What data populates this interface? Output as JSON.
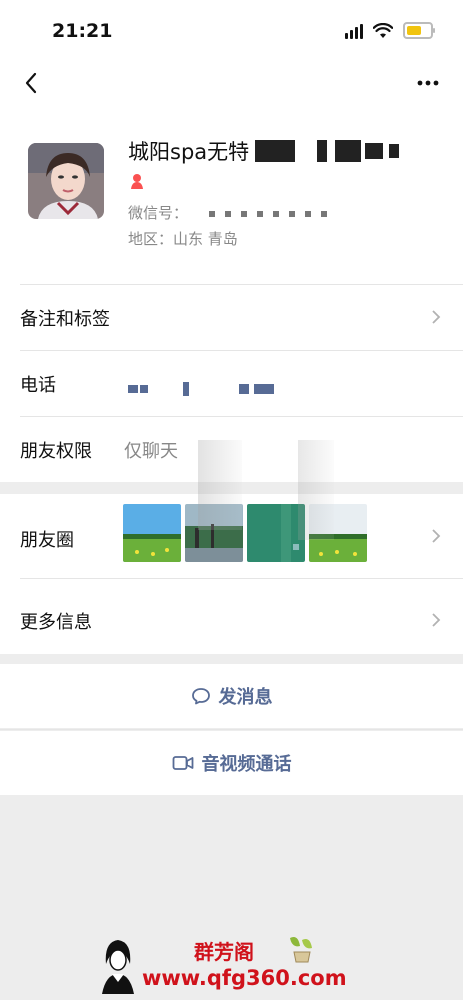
{
  "status": {
    "time": "21:21"
  },
  "nav": {
    "back_icon": "chevron-left-icon",
    "more_icon": "more-dots-icon"
  },
  "profile": {
    "name": "城阳spa无特",
    "wechat_id_label": "微信号：",
    "region_label": "地区：",
    "region_value": "山东 青岛"
  },
  "rows": {
    "remark": {
      "label": "备注和标签"
    },
    "phone": {
      "label": "电话"
    },
    "friend_permission": {
      "label": "朋友权限",
      "value": "仅聊天"
    },
    "moments": {
      "label": "朋友圈"
    },
    "more_info": {
      "label": "更多信息"
    }
  },
  "actions": {
    "send_message": "发消息",
    "video_call": "音视频通话"
  },
  "watermark": {
    "title": "群芳阁",
    "url": "www.qfg360.com"
  },
  "colors": {
    "link": "#576b95",
    "bg": "#ededed",
    "watermark": "#d0121b"
  }
}
